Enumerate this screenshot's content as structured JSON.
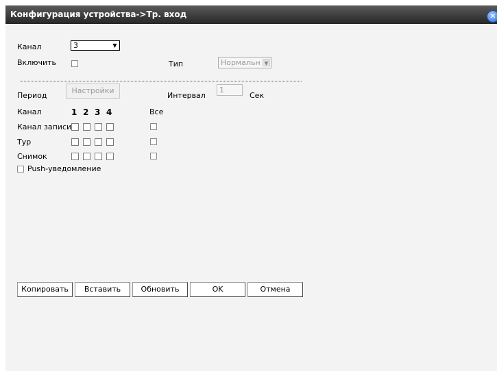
{
  "window": {
    "title": "Конфигурация устройства->Тр. вход",
    "close_glyph": "✕"
  },
  "form": {
    "channel_label": "Канал",
    "channel_value": "3",
    "enable_label": "Включить",
    "type_label": "Тип",
    "type_value": "Нормальн",
    "period_label": "Период",
    "settings_button": "Настройки",
    "interval_label": "Интервал",
    "interval_value": "1",
    "interval_unit": "Сек"
  },
  "grid": {
    "channel_header": "Канал",
    "numbers": [
      "1",
      "2",
      "3",
      "4"
    ],
    "all_label": "Все",
    "rows": [
      "Канал записи",
      "Тур",
      "Снимок"
    ],
    "push_label": "Push-уведомление"
  },
  "buttons": {
    "copy": "Копировать",
    "paste": "Вставить",
    "refresh": "Обновить",
    "ok": "OK",
    "cancel": "Отмена"
  },
  "icons": {
    "dropdown": "arrow-down-icon",
    "close": "close-icon"
  }
}
